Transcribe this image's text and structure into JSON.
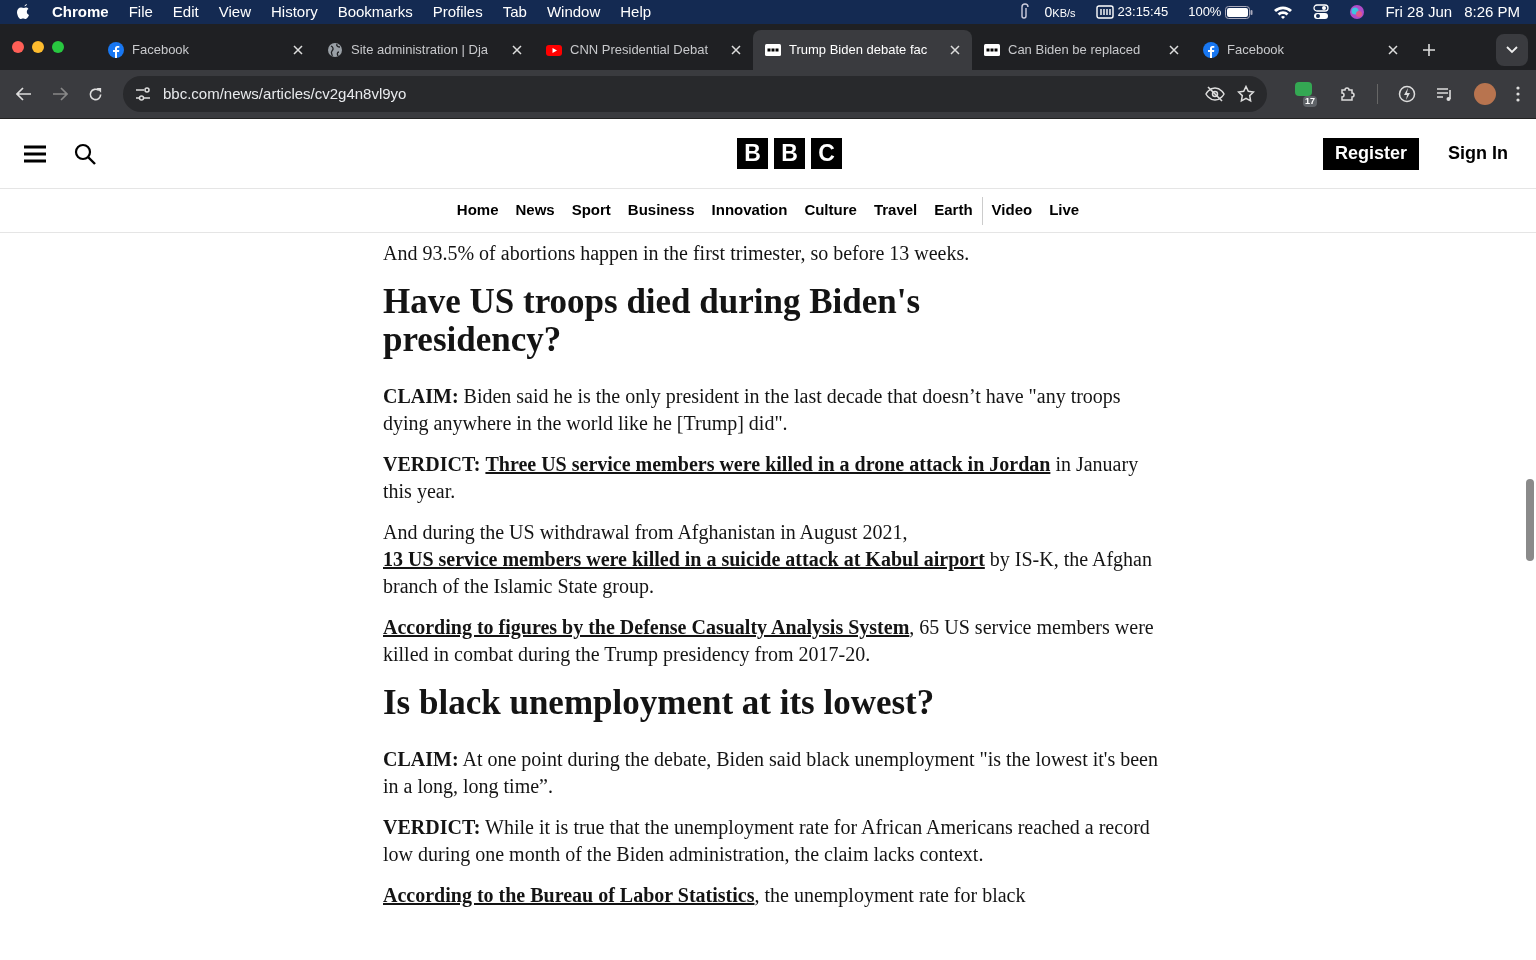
{
  "menu_bar": {
    "app": "Chrome",
    "items": [
      "File",
      "Edit",
      "View",
      "History",
      "Bookmarks",
      "Profiles",
      "Tab",
      "Window",
      "Help"
    ],
    "network": "0",
    "network_unit": "KB/s",
    "timer": "23:15:45",
    "battery": "100%",
    "date": "Fri 28 Jun",
    "time": "8:26 PM"
  },
  "tabs": [
    {
      "title": "Facebook",
      "kind": "facebook",
      "selected": false
    },
    {
      "title": "Site administration | Dja",
      "kind": "globe",
      "selected": false
    },
    {
      "title": "CNN Presidential Debat",
      "kind": "youtube",
      "selected": false
    },
    {
      "title": "Trump Biden debate fac",
      "kind": "bbc",
      "selected": true
    },
    {
      "title": "Can Biden be replaced",
      "kind": "bbc",
      "selected": false
    },
    {
      "title": "Facebook",
      "kind": "facebook",
      "selected": false
    }
  ],
  "address_bar": {
    "url": "bbc.com/news/articles/cv2g4n8vl9yo"
  },
  "extension_badge": "17",
  "site": {
    "logo": [
      "B",
      "B",
      "C"
    ],
    "register": "Register",
    "sign_in": "Sign In",
    "nav": [
      "Home",
      "News",
      "Sport",
      "Business",
      "Innovation",
      "Culture",
      "Travel",
      "Earth",
      "Video",
      "Live"
    ]
  },
  "article": [
    {
      "kind": "para",
      "parts": [
        {
          "text": "And 93.5% of abortions happen in the first trimester, so before 13 weeks.",
          "link": false
        }
      ]
    },
    {
      "kind": "heading",
      "text": "Have US troops died during Biden's presidency?"
    },
    {
      "kind": "para",
      "parts": [
        {
          "text": "**CLAIM:** Biden said he is the only president in the last decade that doesn’t have \"any troops dying anywhere in the world like he [Trump] did\".",
          "link": false
        }
      ]
    },
    {
      "kind": "para",
      "parts": [
        {
          "text": "**VERDICT:** ",
          "link": false
        },
        {
          "text": "Three US service members were killed in a drone attack in Jordan",
          "link": true
        },
        {
          "text": " in January this year.",
          "link": false
        }
      ]
    },
    {
      "kind": "para",
      "parts": [
        {
          "text": "And during the US withdrawal from Afghanistan in August 2021, ",
          "link": false
        },
        {
          "text": "13 US service members were killed in a suicide attack at Kabul airport",
          "link": true
        },
        {
          "text": " by IS-K, the Afghan branch of the Islamic State group.",
          "link": false
        }
      ]
    },
    {
      "kind": "para",
      "parts": [
        {
          "text": "According to figures by the Defense Casualty Analysis System",
          "link": true
        },
        {
          "text": ", 65 US service members were killed in combat during the Trump presidency from 2017-20.",
          "link": false
        }
      ]
    },
    {
      "kind": "heading",
      "text": "Is black unemployment at its lowest?"
    },
    {
      "kind": "para",
      "parts": [
        {
          "text": "**CLAIM:** At one point during the debate, Biden said black unemployment \"is the lowest it's been in a long, long time”.",
          "link": false
        }
      ]
    },
    {
      "kind": "para",
      "parts": [
        {
          "text": "**VERDICT:** While it is true that the unemployment rate for African Americans reached a record low during one month of the Biden administration, the claim lacks context.",
          "link": false
        }
      ]
    },
    {
      "kind": "para",
      "parts": [
        {
          "text": "According to the Bureau of Labor Statistics",
          "link": true
        },
        {
          "text": ", the unemployment rate for black",
          "link": false
        }
      ]
    }
  ]
}
